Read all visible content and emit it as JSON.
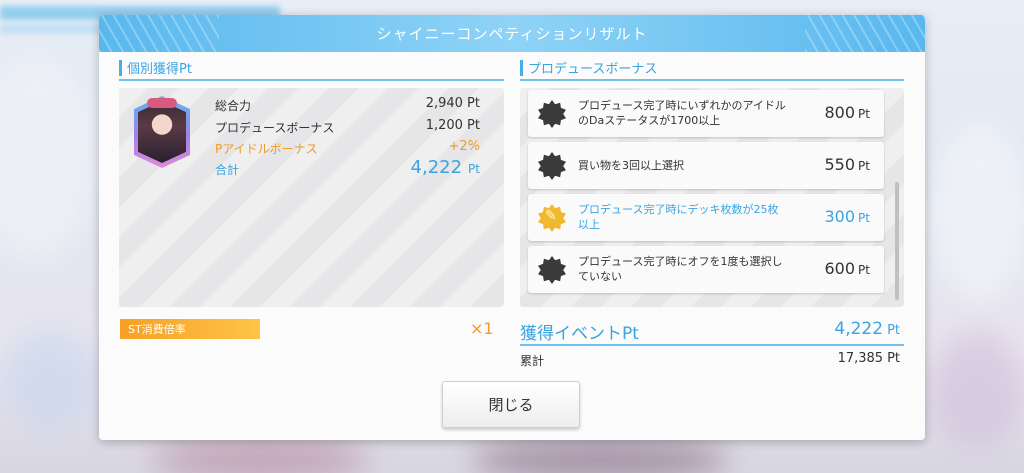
{
  "dialog": {
    "title": "シャイニーコンペティションリザルト"
  },
  "personal": {
    "heading": "個別獲得Pt",
    "rows": [
      {
        "label": "総合力",
        "value": "2,940 Pt"
      },
      {
        "label": "プロデュースボーナス",
        "value": "1,200 Pt"
      },
      {
        "label": "Pアイドルボーナス",
        "value": "+2%"
      },
      {
        "label": "合計",
        "value": "4,222",
        "unit": "Pt"
      }
    ]
  },
  "produce_bonus": {
    "heading": "プロデュースボーナス",
    "items": [
      {
        "text": "プロデュース完了時にいずれかのアイドルのDaステータスが1700以上",
        "points": "800",
        "unit": "Pt",
        "achieved": false,
        "icon": "badge-icon"
      },
      {
        "text": "買い物を3回以上選択",
        "points": "550",
        "unit": "Pt",
        "achieved": false,
        "icon": "badge-icon"
      },
      {
        "text": "プロデュース完了時にデッキ枚数が25枚以上",
        "points": "300",
        "unit": "Pt",
        "achieved": true,
        "icon": "gold-badge-icon"
      },
      {
        "text": "プロデュース完了時にオフを1度も選択していない",
        "points": "600",
        "unit": "Pt",
        "achieved": false,
        "icon": "badge-icon"
      }
    ]
  },
  "st_rate": {
    "label": "ST消費倍率",
    "value": "×1"
  },
  "event": {
    "label": "獲得イベントPt",
    "value": "4,222",
    "unit": "Pt",
    "total_label": "累計",
    "total_value": "17,385",
    "total_unit": "Pt"
  },
  "close_button": {
    "label": "閉じる"
  },
  "colors": {
    "accent": "#3aa4e0",
    "orange": "#f19b22",
    "title_bar": "#58b8ee"
  }
}
